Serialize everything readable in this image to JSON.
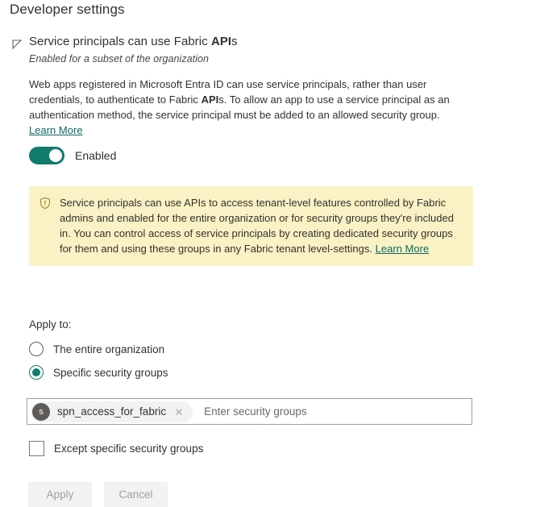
{
  "page": {
    "title": "Developer settings"
  },
  "setting": {
    "title_prefix": "Service principals can use Fabric ",
    "title_bold": "API",
    "title_suffix": "s",
    "subtitle": "Enabled for a subset of the organization",
    "description_part1": "Web apps registered in Microsoft Entra ID can use service principals, rather than user credentials, to authenticate to Fabric ",
    "description_bold": "API",
    "description_part2": "s. To allow an app to use a service principal as an authentication method, the service principal must be added to an allowed security group. ",
    "learn_more": "Learn More",
    "collapse_icon": "triangle-collapse-icon"
  },
  "toggle": {
    "label": "Enabled",
    "state": "on",
    "color": "#107c6c"
  },
  "warning": {
    "icon": "shield-alert-icon",
    "text": "Service principals can use APIs to access tenant-level features controlled by Fabric admins and enabled for the entire organization or for security groups they're included in. You can control access of service principals by creating dedicated security groups for them and using these groups in any Fabric tenant level-settings. ",
    "learn_more": "Learn More",
    "background": "#faf2c4"
  },
  "apply_to": {
    "label": "Apply to:",
    "options": [
      {
        "label": "The entire organization",
        "selected": false
      },
      {
        "label": "Specific security groups",
        "selected": true
      }
    ]
  },
  "security_groups": {
    "placeholder": "Enter security groups",
    "value": "",
    "chips": [
      {
        "avatar_initial": "s",
        "label": "spn_access_for_fabric",
        "remove_icon": "close-icon"
      }
    ]
  },
  "except_checkbox": {
    "label": "Except specific security groups",
    "checked": false
  },
  "actions": {
    "apply_label": "Apply",
    "cancel_label": "Cancel",
    "disabled": true
  }
}
